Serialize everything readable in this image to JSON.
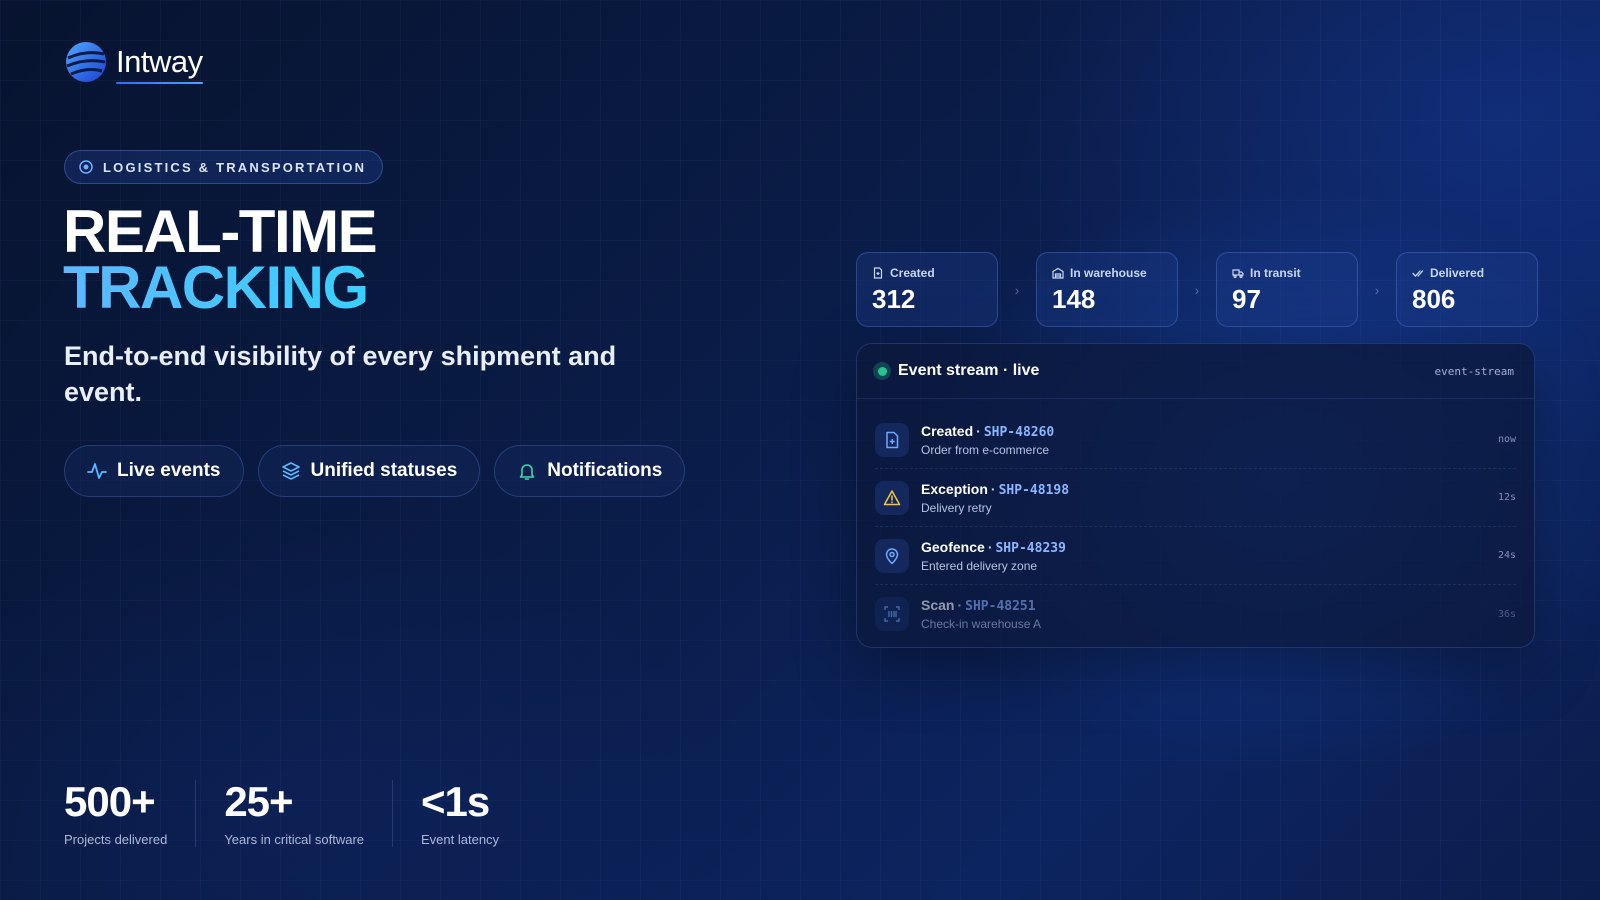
{
  "brand": {
    "name": "Intway"
  },
  "tag": {
    "label": "LOGISTICS & TRANSPORTATION"
  },
  "headline": {
    "line1": "REAL-TIME",
    "line2": "TRACKING"
  },
  "subhead": "End-to-end visibility of every shipment and event.",
  "chips": [
    {
      "label": "Live events",
      "icon": "activity-icon"
    },
    {
      "label": "Unified statuses",
      "icon": "layers-icon"
    },
    {
      "label": "Notifications",
      "icon": "bell-icon"
    }
  ],
  "stats": [
    {
      "value": "500+",
      "label": "Projects delivered"
    },
    {
      "value": "25+",
      "label": "Years in critical software"
    },
    {
      "value": "<1s",
      "label": "Event latency"
    }
  ],
  "statuses": [
    {
      "label": "Created",
      "value": "312",
      "icon": "file-icon"
    },
    {
      "label": "In warehouse",
      "value": "148",
      "icon": "warehouse-icon"
    },
    {
      "label": "In transit",
      "value": "97",
      "icon": "truck-icon"
    },
    {
      "label": "Delivered",
      "value": "806",
      "icon": "check-icon"
    }
  ],
  "stream": {
    "title": "Event stream · live",
    "tag": "event-stream",
    "events": [
      {
        "type": "Created",
        "id": "SHP-48260",
        "detail": "Order from e-commerce",
        "time": "now",
        "icon": "file-plus-icon"
      },
      {
        "type": "Exception",
        "id": "SHP-48198",
        "detail": "Delivery retry",
        "time": "12s",
        "icon": "warning-icon"
      },
      {
        "type": "Geofence",
        "id": "SHP-48239",
        "detail": "Entered delivery zone",
        "time": "24s",
        "icon": "map-pin-icon"
      },
      {
        "type": "Scan",
        "id": "SHP-48251",
        "detail": "Check-in warehouse A",
        "time": "36s",
        "icon": "barcode-icon"
      }
    ]
  },
  "colors": {
    "accent": "#37d1ff",
    "live": "#22c58c",
    "warning": "#f5c542",
    "id_text": "#8ab6ff"
  }
}
